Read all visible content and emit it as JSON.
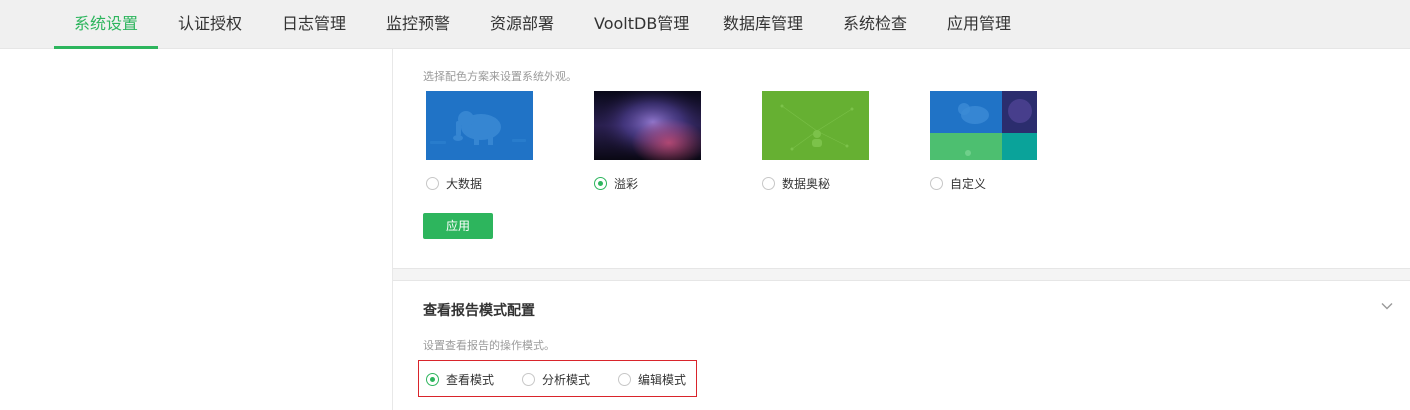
{
  "nav": {
    "tabs": [
      {
        "label": "系统设置",
        "active": true
      },
      {
        "label": "认证授权"
      },
      {
        "label": "日志管理"
      },
      {
        "label": "监控预警"
      },
      {
        "label": "资源部署"
      },
      {
        "label": "VooltDB管理"
      },
      {
        "label": "数据库管理"
      },
      {
        "label": "系统检查"
      },
      {
        "label": "应用管理"
      }
    ]
  },
  "theme_section": {
    "description": "选择配色方案来设置系统外观。",
    "options": [
      {
        "label": "大数据",
        "checked": false,
        "icon": "elephant-thumbnail"
      },
      {
        "label": "溢彩",
        "checked": true,
        "icon": "aurora-thumbnail"
      },
      {
        "label": "数据奥秘",
        "checked": false,
        "icon": "network-thumbnail"
      },
      {
        "label": "自定义",
        "checked": false,
        "icon": "custom-grid-thumbnail"
      }
    ],
    "apply_label": "应用"
  },
  "report_section": {
    "title": "查看报告模式配置",
    "description": "设置查看报告的操作模式。",
    "modes": [
      {
        "label": "查看模式",
        "checked": true
      },
      {
        "label": "分析模式",
        "checked": false
      },
      {
        "label": "编辑模式",
        "checked": false
      }
    ]
  },
  "colors": {
    "accent": "#2db55d",
    "highlight_border": "#d9242b"
  }
}
